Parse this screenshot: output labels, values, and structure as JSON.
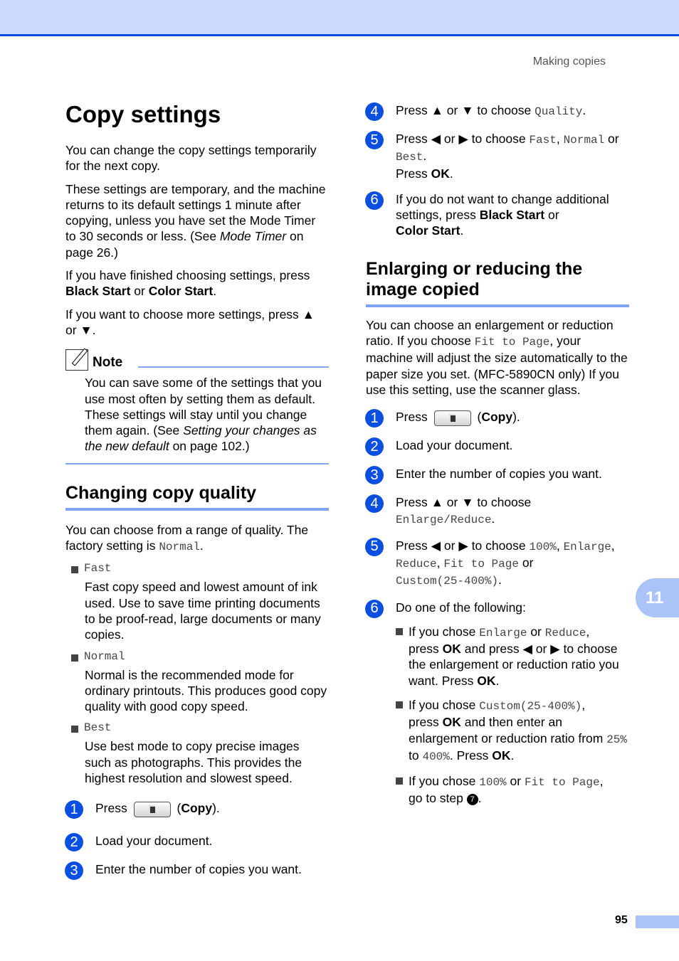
{
  "header": {
    "section_title": "Making copies",
    "chapter_tab": "11",
    "page_number": "95",
    "colors": {
      "band": "#cddcfd",
      "rule": "#0a4fe0",
      "accent": "#7ea4f2",
      "tab": "#aac4f8"
    }
  },
  "left": {
    "title": "Copy settings",
    "intro1": "You can change the copy settings temporarily for the next copy.",
    "intro2a": "These settings are temporary, and the machine returns to its default settings 1 minute after copying, unless you have set the Mode Timer to 30 seconds or less. (See ",
    "intro2_ref": "Mode Timer",
    "intro2b": " on page 26.)",
    "intro3a": "If you have finished choosing settings, press ",
    "black_start": "Black Start",
    "or": " or ",
    "color_start": "Color Start",
    "period": ".",
    "intro4": "If you want to choose more settings, press ▲ or ▼.",
    "note": {
      "label": "Note",
      "text_a": "You can save some of the settings that you use most often by setting them as default. These settings will stay until you change them again. (See ",
      "ref": "Setting your changes as the new default",
      "text_b": " on page 102.)"
    },
    "section2_title": "Changing copy quality",
    "s2_intro_a": "You can choose from a range of quality. The factory setting is ",
    "s2_intro_val": "Normal",
    "options": [
      {
        "name": "Fast",
        "desc": "Fast copy speed and lowest amount of ink used. Use to save time printing documents to be proof-read, large documents or many copies."
      },
      {
        "name": "Normal",
        "desc": "Normal is the recommended mode for ordinary printouts. This produces good copy quality with good copy speed."
      },
      {
        "name": "Best",
        "desc": "Use best mode to copy precise images such as photographs. This provides the highest resolution and slowest speed."
      }
    ],
    "steps": [
      {
        "n": "1",
        "press": "Press ",
        "copy": "Copy"
      },
      {
        "n": "2",
        "text": "Load your document."
      },
      {
        "n": "3",
        "text": "Enter the number of copies you want."
      }
    ]
  },
  "right": {
    "steps_a": [
      {
        "n": "4",
        "text": "Press ▲ or ▼ to choose ",
        "mono": "Quality"
      },
      {
        "n": "5",
        "text": "Press ◀ or ▶ to choose ",
        "m1": "Fast",
        "m2": "Normal",
        "m3": "Best",
        "ok": "OK"
      },
      {
        "n": "6",
        "text": "If you do not want to change additional settings, press "
      }
    ],
    "section_title": "Enlarging or reducing the image copied",
    "intro_a": "You can choose an enlargement or reduction ratio. If you choose ",
    "intro_mono": "Fit to Page",
    "intro_b": ", your machine will adjust the size automatically to the paper size you set. (MFC-5890CN only) If you use this setting, use the scanner glass.",
    "steps_b": [
      {
        "n": "1",
        "press": "Press ",
        "copy": "Copy"
      },
      {
        "n": "2",
        "text": "Load your document."
      },
      {
        "n": "3",
        "text": "Enter the number of copies you want."
      },
      {
        "n": "4",
        "text": "Press ▲ or ▼ to choose ",
        "mono": "Enlarge/Reduce"
      },
      {
        "n": "5",
        "text": "Press ◀ or ▶ to choose ",
        "m1": "100%",
        "m2": "Enlarge",
        "m3": "Reduce",
        "m4": "Fit to Page",
        "m5": "Custom(25-400%)"
      },
      {
        "n": "6",
        "text": "Do one of the following:"
      }
    ],
    "sub": {
      "a1": "If you chose ",
      "a_m1": "Enlarge",
      "a_m2": "Reduce",
      "a2": "press ",
      "a3": " and press ◀ or ▶ to choose the enlargement or reduction ratio you want. Press ",
      "b_m": "Custom(25-400%)",
      "b2": " and then enter an enlargement or reduction ratio from ",
      "b_m2": "25%",
      "b_to": " to ",
      "b_m3": "400%",
      "b3": ". Press ",
      "c_m1": "100%",
      "c_m2": "Fit to Page",
      "c2": "go to step ",
      "c_step": "7",
      "ok": "OK"
    }
  }
}
